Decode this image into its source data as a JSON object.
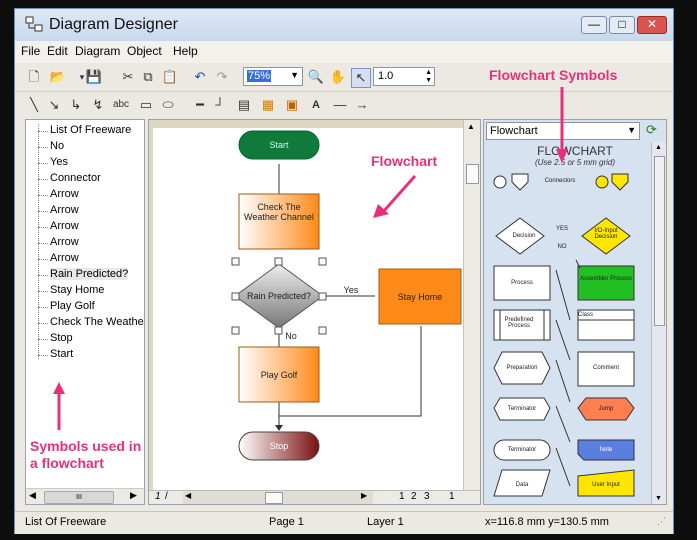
{
  "window": {
    "title": "Diagram Designer"
  },
  "menu": [
    "File",
    "Edit",
    "Diagram",
    "Object",
    "Help"
  ],
  "toolbar": {
    "zoom_value": "75%",
    "line_width_value": "1.0",
    "text_tool_label": "abc"
  },
  "tree": {
    "items": [
      "List Of Freeware",
      "No",
      "Yes",
      "Connector",
      "Arrow",
      "Arrow",
      "Arrow",
      "Arrow",
      "Arrow",
      "Rain Predicted?",
      "Stay Home",
      "Play Golf",
      "Check The Weather",
      "Stop",
      "Start"
    ],
    "scroll_grip": "III"
  },
  "flowchart": {
    "start": "Start",
    "check": "Check The Weather Channel",
    "decision": "Rain Predicted?",
    "yes": "Yes",
    "no": "No",
    "stay_home": "Stay Home",
    "play_golf": "Play Golf",
    "stop": "Stop"
  },
  "canvas_tabs": {
    "left": "1",
    "right": [
      "1",
      "2",
      "3",
      "1"
    ]
  },
  "palette": {
    "dropdown": "Flowchart",
    "heading": "FLOWCHART",
    "subheading": "(Use 2.5 or 5 mm grid)",
    "labels": {
      "connectors": "Connectors",
      "decision": "Decision",
      "yes": "YES",
      "no": "NO",
      "io_decision": "I/O-Input Decision",
      "process": "Process",
      "assembler": "Assembler Process",
      "predefined": "Predefined Process",
      "class": "Class",
      "preparation": "Preparation",
      "comment": "Comment",
      "terminator": "Terminator",
      "jump": "Jump",
      "terminator2": "Terminator",
      "note": "Note",
      "data": "Data",
      "user_input": "User Input"
    }
  },
  "annotations": {
    "flowchart_symbols": "Flowchart Symbols",
    "flowchart": "Flowchart",
    "symbols_used": "Symbols used in a flowchart"
  },
  "status": {
    "left": "List Of Freeware",
    "page": "Page 1",
    "layer": "Layer 1",
    "coords": "x=116.8 mm  y=130.5 mm"
  },
  "colors": {
    "start_fill": "#0f7a3a",
    "process_fill": "#ff8a1a",
    "stop_fill": "#8b1a1a",
    "annotation": "#e8307a"
  }
}
